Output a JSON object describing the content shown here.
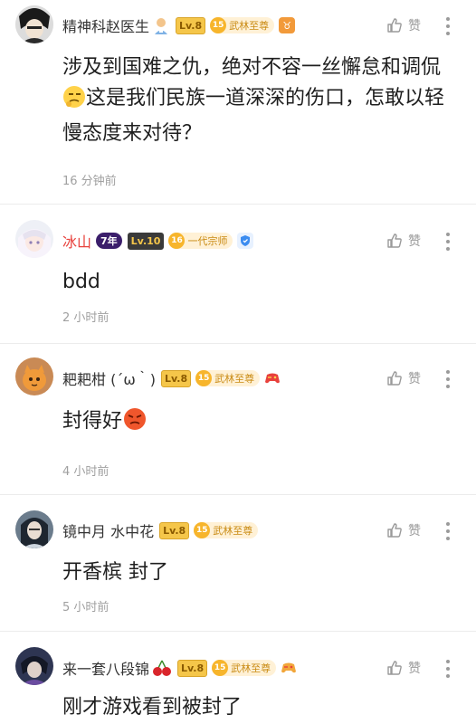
{
  "comments": [
    {
      "user": "精神科赵医生",
      "level": "Lv.8",
      "fan_number": "15",
      "fan_title": "武林至尊",
      "content_part1": "涉及到国难之仇，绝对不容一丝懈怠和调侃",
      "content_part2": "这是我们民族一道深深的伤口，怎敢以轻慢态度来对待？",
      "time": "16 分钟前",
      "like_label": "赞"
    },
    {
      "user": "冰山",
      "years": "7年",
      "level": "Lv.10",
      "fan_number": "16",
      "fan_title": "一代宗师",
      "content": "bdd",
      "time": "2 小时前",
      "like_label": "赞"
    },
    {
      "user": "耙耙柑 (´ω｀)",
      "level": "Lv.8",
      "fan_number": "15",
      "fan_title": "武林至尊",
      "content": "封得好",
      "time": "4 小时前",
      "like_label": "赞"
    },
    {
      "user": "镜中月 水中花",
      "level": "Lv.8",
      "fan_number": "15",
      "fan_title": "武林至尊",
      "content": "开香槟 封了",
      "time": "5 小时前",
      "like_label": "赞"
    },
    {
      "user": "来一套八段锦",
      "level": "Lv.8",
      "fan_number": "15",
      "fan_title": "武林至尊",
      "content": "刚才游戏看到被封了",
      "like_label": "赞"
    }
  ],
  "icons": {
    "like": "thumbs-up-icon",
    "more": "vertical-dots-icon",
    "doctor": "doctor-emoji-icon",
    "taurus": "taurus-badge-icon",
    "shield": "shield-badge-icon",
    "gamepad": "gamepad-icon",
    "cherry": "cherry-emoji-icon"
  },
  "colors": {
    "red_username": "#e8413c",
    "level_badge": "#f5c64a",
    "fan_badge": "#f7b52c",
    "muted_text": "#9a9a9a"
  }
}
